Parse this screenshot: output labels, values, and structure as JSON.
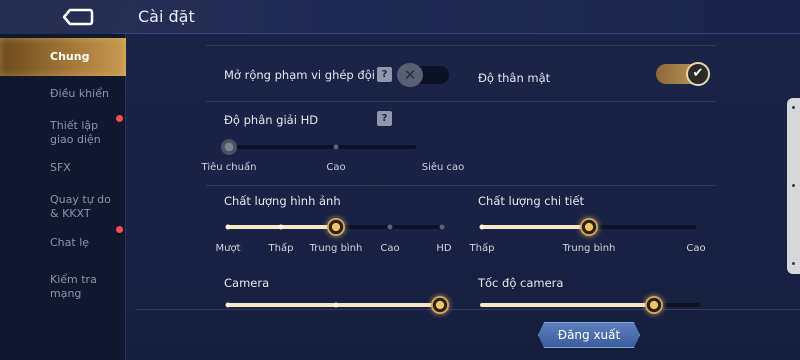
{
  "header": {
    "title": "Cài đặt"
  },
  "sidebar": {
    "items": [
      {
        "label": "Chung",
        "active": true
      },
      {
        "label": "Điều khiển"
      },
      {
        "label": "Thiết lập giao diện",
        "badge": true
      },
      {
        "label": "SFX"
      },
      {
        "label": "Quay tự do & KKXT"
      },
      {
        "label": "Chat lẹ",
        "badge": true
      },
      {
        "label": "Kiểm tra mạng"
      }
    ]
  },
  "settings": {
    "match_range": {
      "label": "Mở rộng phạm vi ghép đội",
      "help": "?",
      "value": false
    },
    "intimacy": {
      "label": "Độ thân mật",
      "value": true
    },
    "resolution": {
      "label": "Độ phân giải HD",
      "help": "?",
      "ticks": [
        "Tiêu chuẩn",
        "Cao",
        "Siêu cao"
      ],
      "selected": "Tiêu chuẩn"
    },
    "image_quality": {
      "label": "Chất lượng hình ảnh",
      "ticks": [
        "Mượt",
        "Thấp",
        "Trung bình",
        "Cao",
        "HD"
      ],
      "selected": "Trung bình"
    },
    "detail_quality": {
      "label": "Chất lượng chi tiết",
      "ticks": [
        "Thấp",
        "Trung bình",
        "Cao"
      ],
      "selected": "Trung bình"
    },
    "camera": {
      "label": "Camera",
      "selected_fraction": 1.0
    },
    "camera_speed": {
      "label": "Tốc độ camera",
      "selected_fraction": 0.8
    }
  },
  "footer": {
    "logout_label": "Đăng xuất"
  },
  "colors": {
    "accent_gold": "#c99b58",
    "panel": "#1a2447",
    "sidebar": "#101830"
  }
}
